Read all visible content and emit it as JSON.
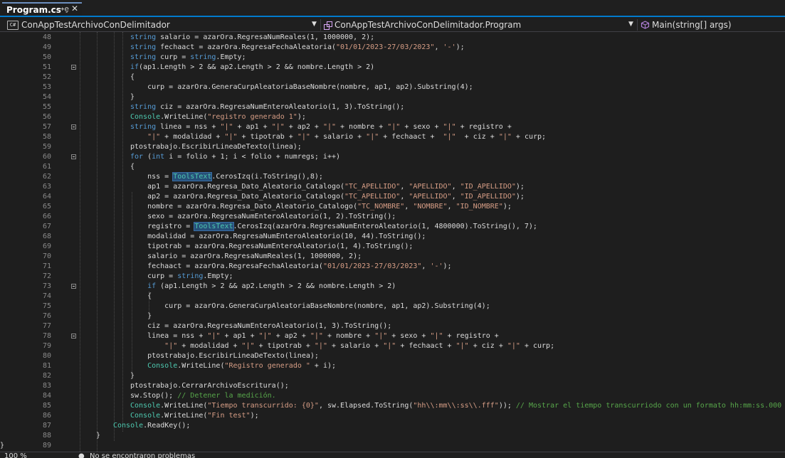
{
  "tab": {
    "title": "Program.cs",
    "pin_glyph": "→ȩ",
    "close_glyph": "✕"
  },
  "nav": {
    "project": "ConAppTestArchivoConDelimitador",
    "class": "ConAppTestArchivoConDelimitador.Program",
    "member": "Main(string[] args)",
    "cs_badge": "C#"
  },
  "colors": {
    "accent": "#007acc",
    "keyword": "#569cd6",
    "type": "#4ec9b0",
    "string": "#d69d85",
    "comment": "#57a64a"
  },
  "code_lines": [
    {
      "n": "48",
      "segs": [
        [
          "string",
          "kw"
        ],
        [
          " salario = azarOra.RegresaNumReales(1, 1000000, 2);",
          ""
        ]
      ]
    },
    {
      "n": "49",
      "segs": [
        [
          "string",
          "kw"
        ],
        [
          " fechaact = azarOra.RegresaFechaAleatoria(",
          ""
        ],
        [
          "\"01/01/2023-27/03/2023\"",
          "str"
        ],
        [
          ", ",
          ""
        ],
        [
          "'-'",
          "str"
        ],
        [
          ");",
          ""
        ]
      ]
    },
    {
      "n": "50",
      "segs": [
        [
          "string",
          "kw"
        ],
        [
          " curp = ",
          ""
        ],
        [
          "string",
          "kw"
        ],
        [
          ".Empty;",
          ""
        ]
      ]
    },
    {
      "n": "51",
      "segs": [
        [
          "if",
          "kw"
        ],
        [
          "(ap1.Length > 2 && ap2.Length > 2 && nombre.Length > 2)",
          ""
        ]
      ]
    },
    {
      "n": "52",
      "segs": [
        [
          "{",
          ""
        ]
      ]
    },
    {
      "n": "53",
      "segs": [
        [
          "    curp = azarOra.GeneraCurpAleatoriaBaseNombre(nombre, ap1, ap2).Substring(4);",
          ""
        ]
      ]
    },
    {
      "n": "54",
      "segs": [
        [
          "}",
          ""
        ]
      ]
    },
    {
      "n": "55",
      "segs": [
        [
          "string",
          "kw"
        ],
        [
          " ciz = azarOra.RegresaNumEnteroAleatorio(1, 3).ToString();",
          ""
        ]
      ]
    },
    {
      "n": "56",
      "segs": [
        [
          "Console",
          "ty"
        ],
        [
          ".WriteLine(",
          ""
        ],
        [
          "\"registro generado 1\"",
          "str"
        ],
        [
          ");",
          ""
        ]
      ]
    },
    {
      "n": "57",
      "segs": [
        [
          "string",
          "kw"
        ],
        [
          " linea = nss + ",
          ""
        ],
        [
          "\"|\"",
          "str"
        ],
        [
          " + ap1 + ",
          ""
        ],
        [
          "\"|\"",
          "str"
        ],
        [
          " + ap2 + ",
          ""
        ],
        [
          "\"|\"",
          "str"
        ],
        [
          " + nombre + ",
          ""
        ],
        [
          "\"|\"",
          "str"
        ],
        [
          " + sexo + ",
          ""
        ],
        [
          "\"|\"",
          "str"
        ],
        [
          " + registro +",
          ""
        ]
      ]
    },
    {
      "n": "58",
      "segs": [
        [
          "    ",
          ""
        ],
        [
          "\"|\"",
          "str"
        ],
        [
          " + modalidad + ",
          ""
        ],
        [
          "\"|\"",
          "str"
        ],
        [
          " + tipotrab + ",
          ""
        ],
        [
          "\"|\"",
          "str"
        ],
        [
          " + salario + ",
          ""
        ],
        [
          "\"|\"",
          "str"
        ],
        [
          " + fechaact +  ",
          ""
        ],
        [
          "\"|\"",
          "str"
        ],
        [
          "  + ciz + ",
          ""
        ],
        [
          "\"|\"",
          "str"
        ],
        [
          " + curp;",
          ""
        ]
      ]
    },
    {
      "n": "59",
      "segs": [
        [
          "ptostrabajo.EscribirLineaDeTexto(linea);",
          ""
        ]
      ]
    },
    {
      "n": "60",
      "segs": [
        [
          "for",
          "kw"
        ],
        [
          " (",
          ""
        ],
        [
          "int",
          "kw"
        ],
        [
          " i = folio + 1; i < folio + numregs; i++)",
          ""
        ]
      ]
    },
    {
      "n": "61",
      "segs": [
        [
          "{",
          ""
        ]
      ]
    },
    {
      "n": "62",
      "segs": [
        [
          "    nss = ",
          ""
        ],
        [
          "ToolsText",
          "hl"
        ],
        [
          ".CerosIzq(i.ToString(),8);",
          ""
        ]
      ]
    },
    {
      "n": "63",
      "segs": [
        [
          "    ap1 = azarOra.Regresa_Dato_Aleatorio_Catalogo(",
          ""
        ],
        [
          "\"TC_APELLIDO\"",
          "str"
        ],
        [
          ", ",
          ""
        ],
        [
          "\"APELLIDO\"",
          "str"
        ],
        [
          ", ",
          ""
        ],
        [
          "\"ID_APELLIDO\"",
          "str"
        ],
        [
          ");",
          ""
        ]
      ]
    },
    {
      "n": "64",
      "segs": [
        [
          "    ap2 = azarOra.Regresa_Dato_Aleatorio_Catalogo(",
          ""
        ],
        [
          "\"TC_APELLIDO\"",
          "str"
        ],
        [
          ", ",
          ""
        ],
        [
          "\"APELLIDO\"",
          "str"
        ],
        [
          ", ",
          ""
        ],
        [
          "\"ID_APELLIDO\"",
          "str"
        ],
        [
          ");",
          ""
        ]
      ]
    },
    {
      "n": "65",
      "segs": [
        [
          "    nombre = azarOra.Regresa_Dato_Aleatorio_Catalogo(",
          ""
        ],
        [
          "\"TC_NOMBRE\"",
          "str"
        ],
        [
          ", ",
          ""
        ],
        [
          "\"NOMBRE\"",
          "str"
        ],
        [
          ", ",
          ""
        ],
        [
          "\"ID_NOMBRE\"",
          "str"
        ],
        [
          ");",
          ""
        ]
      ]
    },
    {
      "n": "66",
      "segs": [
        [
          "    sexo = azarOra.RegresaNumEnteroAleatorio(1, 2).ToString();",
          ""
        ]
      ]
    },
    {
      "n": "67",
      "segs": [
        [
          "    registro = ",
          ""
        ],
        [
          "ToolsText",
          "hl"
        ],
        [
          ".CerosIzq(azarOra.RegresaNumEnteroAleatorio(1, 4800000).ToString(), 7);",
          ""
        ]
      ]
    },
    {
      "n": "68",
      "segs": [
        [
          "    modalidad = azarOra.RegresaNumEnteroAleatorio(10, 44).ToString();",
          ""
        ]
      ]
    },
    {
      "n": "69",
      "segs": [
        [
          "    tipotrab = azarOra.RegresaNumEnteroAleatorio(1, 4).ToString();",
          ""
        ]
      ]
    },
    {
      "n": "70",
      "segs": [
        [
          "    salario = azarOra.RegresaNumReales(1, 1000000, 2);",
          ""
        ]
      ]
    },
    {
      "n": "71",
      "segs": [
        [
          "    fechaact = azarOra.RegresaFechaAleatoria(",
          ""
        ],
        [
          "\"01/01/2023-27/03/2023\"",
          "str"
        ],
        [
          ", ",
          ""
        ],
        [
          "'-'",
          "str"
        ],
        [
          ");",
          ""
        ]
      ]
    },
    {
      "n": "72",
      "segs": [
        [
          "    curp = ",
          ""
        ],
        [
          "string",
          "kw"
        ],
        [
          ".Empty;",
          ""
        ]
      ]
    },
    {
      "n": "73",
      "segs": [
        [
          "    ",
          ""
        ],
        [
          "if",
          "kw"
        ],
        [
          " (ap1.Length > 2 && ap2.Length > 2 && nombre.Length > 2)",
          ""
        ]
      ]
    },
    {
      "n": "74",
      "segs": [
        [
          "    {",
          ""
        ]
      ]
    },
    {
      "n": "75",
      "segs": [
        [
          "        curp = azarOra.GeneraCurpAleatoriaBaseNombre(nombre, ap1, ap2).Substring(4);",
          ""
        ]
      ]
    },
    {
      "n": "76",
      "segs": [
        [
          "    }",
          ""
        ]
      ]
    },
    {
      "n": "77",
      "segs": [
        [
          "    ciz = azarOra.RegresaNumEnteroAleatorio(1, 3).ToString();",
          ""
        ]
      ]
    },
    {
      "n": "78",
      "segs": [
        [
          "    linea = nss + ",
          ""
        ],
        [
          "\"|\"",
          "str"
        ],
        [
          " + ap1 + ",
          ""
        ],
        [
          "\"|\"",
          "str"
        ],
        [
          " + ap2 + ",
          ""
        ],
        [
          "\"|\"",
          "str"
        ],
        [
          " + nombre + ",
          ""
        ],
        [
          "\"|\"",
          "str"
        ],
        [
          " + sexo + ",
          ""
        ],
        [
          "\"|\"",
          "str"
        ],
        [
          " + registro +",
          ""
        ]
      ]
    },
    {
      "n": "79",
      "segs": [
        [
          "        ",
          ""
        ],
        [
          "\"|\"",
          "str"
        ],
        [
          " + modalidad + ",
          ""
        ],
        [
          "\"|\"",
          "str"
        ],
        [
          " + tipotrab + ",
          ""
        ],
        [
          "\"|\"",
          "str"
        ],
        [
          " + salario + ",
          ""
        ],
        [
          "\"|\"",
          "str"
        ],
        [
          " + fechaact + ",
          ""
        ],
        [
          "\"|\"",
          "str"
        ],
        [
          " + ciz + ",
          ""
        ],
        [
          "\"|\"",
          "str"
        ],
        [
          " + curp;",
          ""
        ]
      ]
    },
    {
      "n": "80",
      "segs": [
        [
          "    ptostrabajo.EscribirLineaDeTexto(linea);",
          ""
        ]
      ]
    },
    {
      "n": "81",
      "segs": [
        [
          "    ",
          ""
        ],
        [
          "Console",
          "ty"
        ],
        [
          ".WriteLine(",
          ""
        ],
        [
          "\"Registro generado \"",
          "str"
        ],
        [
          " + i);",
          ""
        ]
      ]
    },
    {
      "n": "82",
      "segs": [
        [
          "}",
          ""
        ]
      ]
    },
    {
      "n": "83",
      "segs": [
        [
          "ptostrabajo.CerrarArchivoEscritura();",
          ""
        ]
      ]
    },
    {
      "n": "84",
      "segs": [
        [
          "sw.Stop(); ",
          ""
        ],
        [
          "// Detener la medición.",
          "com"
        ]
      ]
    },
    {
      "n": "85",
      "segs": [
        [
          "Console",
          "ty"
        ],
        [
          ".WriteLine(",
          ""
        ],
        [
          "\"Tiempo transcurrido: {0}\"",
          "str"
        ],
        [
          ", sw.Elapsed.ToString(",
          ""
        ],
        [
          "\"hh\\\\:mm\\\\:ss\\\\.fff\"",
          "str"
        ],
        [
          ")); ",
          ""
        ],
        [
          "// Mostrar el tiempo transcurriodo con un formato hh:mm:ss.000",
          "com"
        ]
      ]
    },
    {
      "n": "86",
      "segs": [
        [
          "Console",
          "ty"
        ],
        [
          ".WriteLine(",
          ""
        ],
        [
          "\"Fin test\"",
          "str"
        ],
        [
          ");",
          ""
        ]
      ]
    },
    {
      "n": "87",
      "segs": [
        [
          "Console",
          "ty"
        ],
        [
          ".ReadKey();",
          ""
        ]
      ]
    },
    {
      "n": "88",
      "segs": [
        [
          "}",
          ""
        ]
      ]
    },
    {
      "n": "89",
      "segs": [
        [
          "}",
          ""
        ]
      ]
    }
  ],
  "status": {
    "zoom": "100 %",
    "issues": "No se encontraron problemas"
  }
}
